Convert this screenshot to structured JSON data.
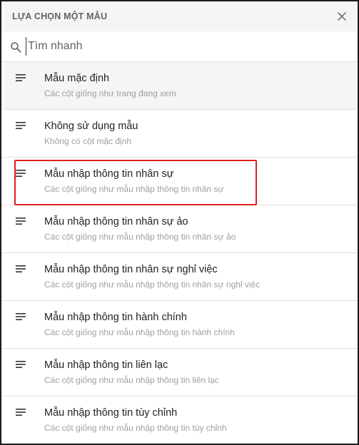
{
  "dialog": {
    "title": "LỰA CHỌN MỘT MẪU"
  },
  "search": {
    "placeholder": "Tìm nhanh",
    "value": ""
  },
  "templates": [
    {
      "title": "Mẫu mặc định",
      "desc": "Các cột giống như trang đang xem"
    },
    {
      "title": "Không sử dụng mẫu",
      "desc": "Không có cột mặc định"
    },
    {
      "title": "Mẫu nhập thông tin nhân sự",
      "desc": "Các cột giống như mẫu nhập thông tin nhân sự"
    },
    {
      "title": "Mẫu nhập thông tin nhân sự ảo",
      "desc": "Các cột giống như mẫu nhập thông tin nhân sự ảo"
    },
    {
      "title": "Mẫu nhập thông tin nhân sự nghỉ việc",
      "desc": "Các cột giống như mẫu nhập thông tin nhân sự nghỉ việc"
    },
    {
      "title": "Mẫu nhập thông tin hành chính",
      "desc": "Các cột giống như mẫu nhập thông tin hành chính"
    },
    {
      "title": "Mẫu nhập thông tin liên lạc",
      "desc": "Các cột giống như mẫu nhập thông tin liên lạc"
    },
    {
      "title": "Mẫu nhập thông tin tùy chỉnh",
      "desc": "Các cột giống như mẫu nhập thông tin tùy chỉnh"
    }
  ],
  "icons": {
    "close": "close-icon",
    "search": "search-icon",
    "template": "list-lines-icon"
  },
  "colors": {
    "highlight": "#e02020",
    "header_bg": "#f5f5f5",
    "default_row_bg": "#f5f5f5"
  }
}
